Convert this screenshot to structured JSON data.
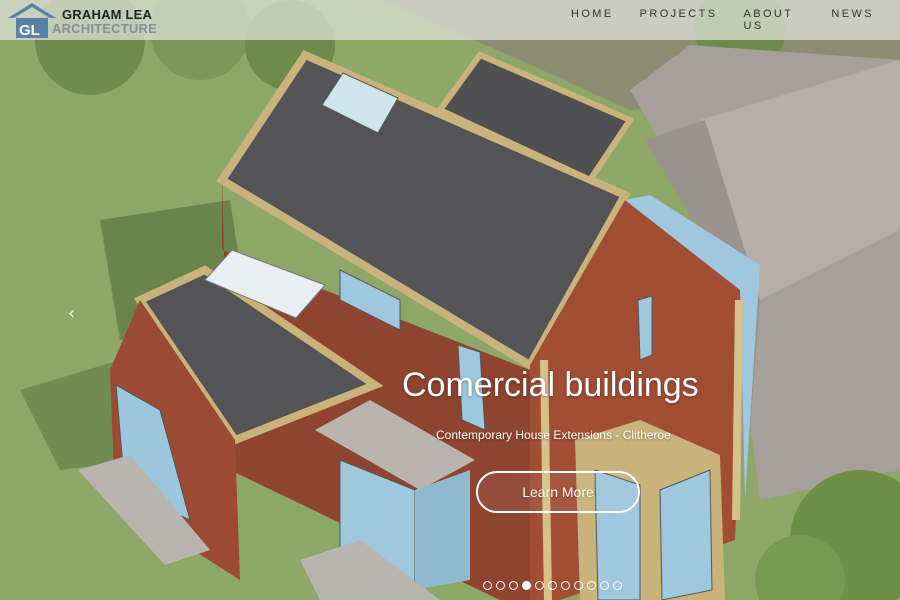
{
  "brand": {
    "initials": "GL",
    "name_line1": "GRAHAM LEA",
    "name_line2": "ARCHITECTURE"
  },
  "nav": {
    "items": [
      {
        "label": "HOME"
      },
      {
        "label": "PROJECTS"
      },
      {
        "label": "ABOUT US"
      },
      {
        "label": "NEWS"
      }
    ]
  },
  "slider": {
    "prev_icon": "chevron-left-icon",
    "title": "Comercial buildings",
    "subtitle": "Contemporary House Extensions - Clitheroe",
    "cta_label": "Learn More",
    "slide_count": 11,
    "active_index": 3
  },
  "colors": {
    "brand_blue": "#5a7fa8",
    "brand_gray": "#8a8f96",
    "nav_bar": "#e1e4dc",
    "cta_border": "#ffffff"
  }
}
